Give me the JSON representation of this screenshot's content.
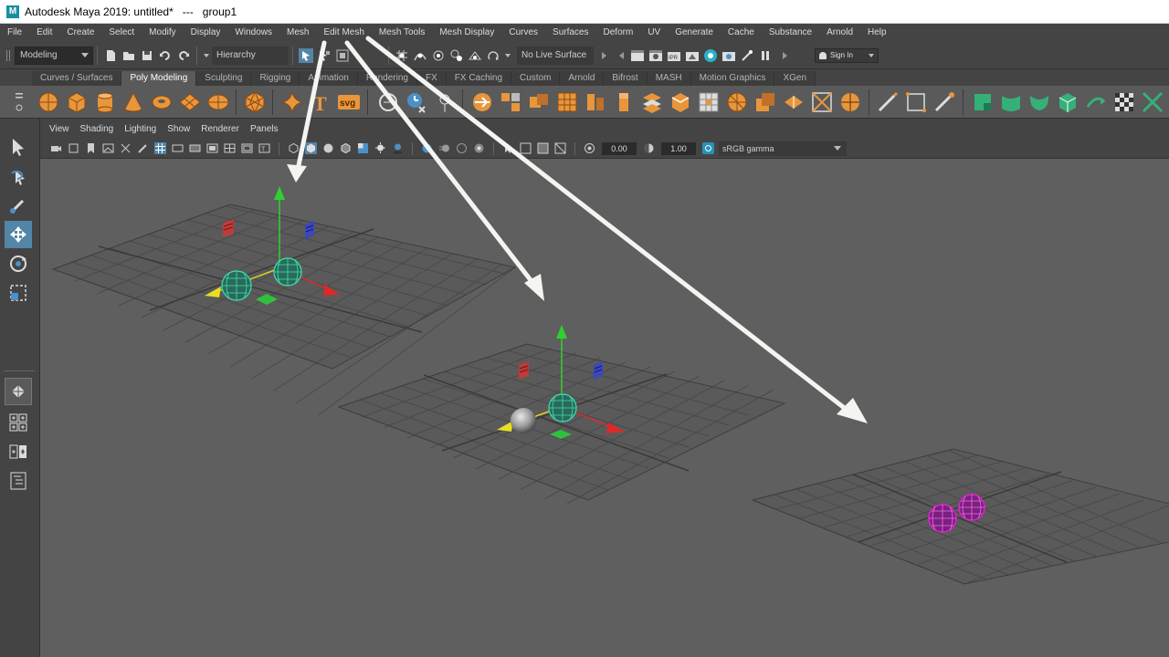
{
  "window": {
    "logo_letter": "M",
    "title": "Autodesk Maya 2019: untitled*   ---   group1"
  },
  "menubar": {
    "items": [
      "File",
      "Edit",
      "Create",
      "Select",
      "Modify",
      "Display",
      "Windows",
      "Mesh",
      "Edit Mesh",
      "Mesh Tools",
      "Mesh Display",
      "Curves",
      "Surfaces",
      "Deform",
      "UV",
      "Generate",
      "Cache",
      "Substance",
      "Arnold",
      "Help"
    ]
  },
  "statusline": {
    "menuset": "Modeling",
    "selection_mode": "Hierarchy",
    "live_surface": "No Live Surface",
    "sign_in": "Sign In"
  },
  "shelf": {
    "tabs": [
      "Curves / Surfaces",
      "Poly Modeling",
      "Sculpting",
      "Rigging",
      "Animation",
      "Rendering",
      "FX",
      "FX Caching",
      "Custom",
      "Arnold",
      "Bifrost",
      "MASH",
      "Motion Graphics",
      "XGen"
    ],
    "active_tab": "Poly Modeling",
    "text_icon": "T",
    "svg_icon": "svg"
  },
  "panel": {
    "menus": [
      "View",
      "Shading",
      "Lighting",
      "Show",
      "Renderer",
      "Panels"
    ],
    "exposure": "0.00",
    "gamma": "1.00",
    "color_space": "sRGB gamma"
  },
  "toolbox": {
    "tools": [
      "select-tool-icon",
      "lasso-tool-icon",
      "paint-select-icon",
      "move-tool-icon",
      "rotate-tool-icon",
      "scale-tool-icon"
    ],
    "active_tool": "move-tool-icon"
  },
  "colors": {
    "menubar_bg": "#444444",
    "viewport_bg": "#5f5f5f",
    "selected_wire": "#3fe0b0",
    "highlight_wire": "#e020d0",
    "shelf_icon": "#e8963c",
    "shelf_icon_green": "#35b078",
    "arrow_annotation": "#f4f4f0"
  }
}
